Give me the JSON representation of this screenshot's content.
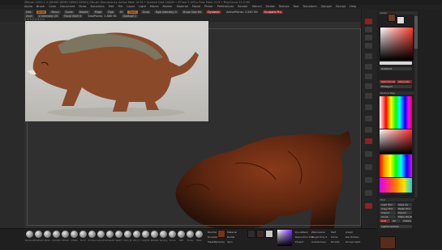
{
  "window": {
    "title": "ZBrush 2023.1.2 [DEMO DEMO DEMO DEMO]   ZBrush Document   ▸ Active Mem 4179 • Scratch Disk 10800 • ZTime 2.453 ▸ Free Mem 22.9 • PolyCount 15.2 Mil"
  },
  "menu": {
    "items": [
      "Alpha",
      "Brush",
      "Color",
      "Document",
      "Draw",
      "Dynamics",
      "Edit",
      "File",
      "Layer",
      "Light",
      "Macro",
      "Marker",
      "Material",
      "Movie",
      "Picker",
      "Preferences",
      "Render",
      "Stencil",
      "Stroke",
      "Texture",
      "Tool",
      "Transform",
      "Zplugin",
      "Zscript",
      "Help"
    ]
  },
  "toolbar": {
    "edit": "Edit",
    "draw": "Draw",
    "move": "Move",
    "scale": "Scale",
    "rotate": "Rotate",
    "mrgb": "Mrgb",
    "rgb": "Rgb",
    "m": "M",
    "zadd": "Zadd",
    "zsub": "Zsub",
    "zcut": "Zcut",
    "rgb_intensity": "Rgb Intensity 0",
    "z_intensity": "Z Intensity 25",
    "draw_size": "Draw Size 64",
    "focal_shift": "Focal Shift 0",
    "dynamic": "Dynamic",
    "active_points": "ActivePoints: 2.845 Mil",
    "total_points": "TotalPoints: 2.886 Mil",
    "subtool": "Subtool 1",
    "sculptris": "Sculptris Pro",
    "coords": "3.5,5.2,0.5,0.5"
  },
  "right_panel": {
    "header": "Color",
    "gradient_label": "Gradient",
    "switch_color": "SwitchColor",
    "alternate": "Alternate",
    "fill_object": "FillObject",
    "texture_map": "Texture Map",
    "tool_header": "Tool",
    "load_tool": "Load Tool",
    "save_as": "Save As",
    "copy_tool": "Copy Tool",
    "paste_tool": "Paste Tool",
    "import": "Import",
    "export": "Export",
    "lightbox": "Lightbox▸Tools",
    "clone": "Clone",
    "make_polymesh": "Make PolyMesh3D",
    "goz": "GoZ",
    "all": "All",
    "visible": "Visible"
  },
  "bottom_shelf": {
    "brushes": [
      "Standard",
      "ClayBuild",
      "Move",
      "DamStd",
      "hPolish",
      "Inflate",
      "Pinch",
      "TrimDyn",
      "Smooth",
      "SnakeHk",
      "Slash3",
      "Dam_St",
      "Orb_Cr",
      "ClayTub",
      "ZModel",
      "Topolog",
      "Curve",
      "IMM",
      "Chisel",
      "Mask"
    ],
    "backface_mask": "BackfaceMask",
    "doublesided": "DoubleSided",
    "material": "Material",
    "radial": "Radial",
    "mask_by_cavity": "MaskByCavity",
    "sym": "Sym",
    "dynamesh": "DynaMesh",
    "resolution": "Resolution 512",
    "project": "Project",
    "auto_groups": "AutoGroups",
    "polish": "Polish",
    "zremesher": "ZRemesher",
    "target": "Target Poly 5",
    "half": "Half",
    "same": "Same",
    "double": "Double",
    "adapt": "Adapt",
    "del_hidden": "Del Hidden",
    "groups_split": "Groups Split"
  },
  "colors": {
    "accent_orange": "#b56a2c",
    "accent_red": "#8f2424",
    "sculpt_red": "#7a3318"
  }
}
